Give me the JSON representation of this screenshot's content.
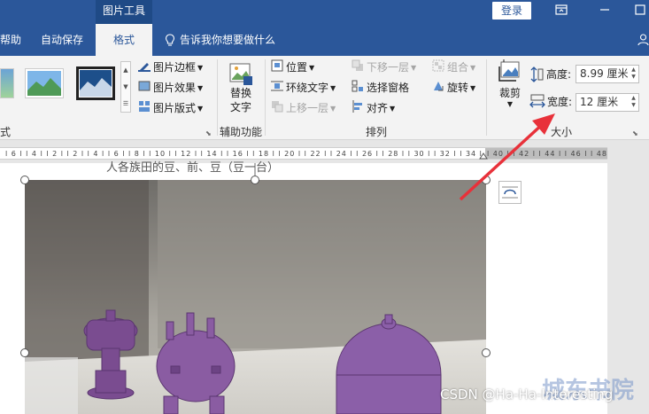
{
  "title_bar": {
    "context_tab_title": "图片工具",
    "login_label": "登录"
  },
  "tabs": [
    {
      "label": "帮助"
    },
    {
      "label": "自动保存"
    },
    {
      "label": "格式"
    },
    {
      "label": "告诉我你想要做什么"
    }
  ],
  "ribbon": {
    "picture_styles": {
      "border_label": "图片边框",
      "effects_label": "图片效果",
      "layout_label": "图片版式",
      "group_label": "式"
    },
    "accessibility": {
      "replace_label_1": "替换",
      "replace_label_2": "文字",
      "group_label": "辅助功能"
    },
    "arrange": {
      "position_label": "位置",
      "wrap_text_label": "环绕文字",
      "bring_forward_label": "上移一层",
      "send_backward_label": "下移一层",
      "selection_pane_label": "选择窗格",
      "align_label": "对齐",
      "group_label": "组合",
      "rotate_label": "旋转",
      "group_name": "排列"
    },
    "size": {
      "crop_label": "裁剪",
      "height_label": "高度:",
      "height_value": "8.99 厘米",
      "width_label": "宽度:",
      "width_value": "12 厘米",
      "group_name": "大小"
    }
  },
  "ruler": {
    "text": "l 6 l   l 4 l   l 2 l   l 2 l   l 4 l   l 6 l   l 8 l   l 10 l   l 12 l   l 14 l   l 16 l   l 18 l   l 20 l   l 22 l   l 24 l   l 26 l   l 28 l   l 30 l   l 32 l   l 34 l   l 36 l   l 38 l",
    "right_text": "l 40 l   l 42 l   l 44 l   l 46 l   l 48"
  },
  "document": {
    "partial_text": "人各族田的豆、前、豆（豆一台）"
  },
  "watermark": {
    "csdn": "CSDN @Ha-Ha-Interesting",
    "site": "城东书院"
  },
  "colors": {
    "accent": "#2b579a",
    "arrow": "#e8313a"
  }
}
